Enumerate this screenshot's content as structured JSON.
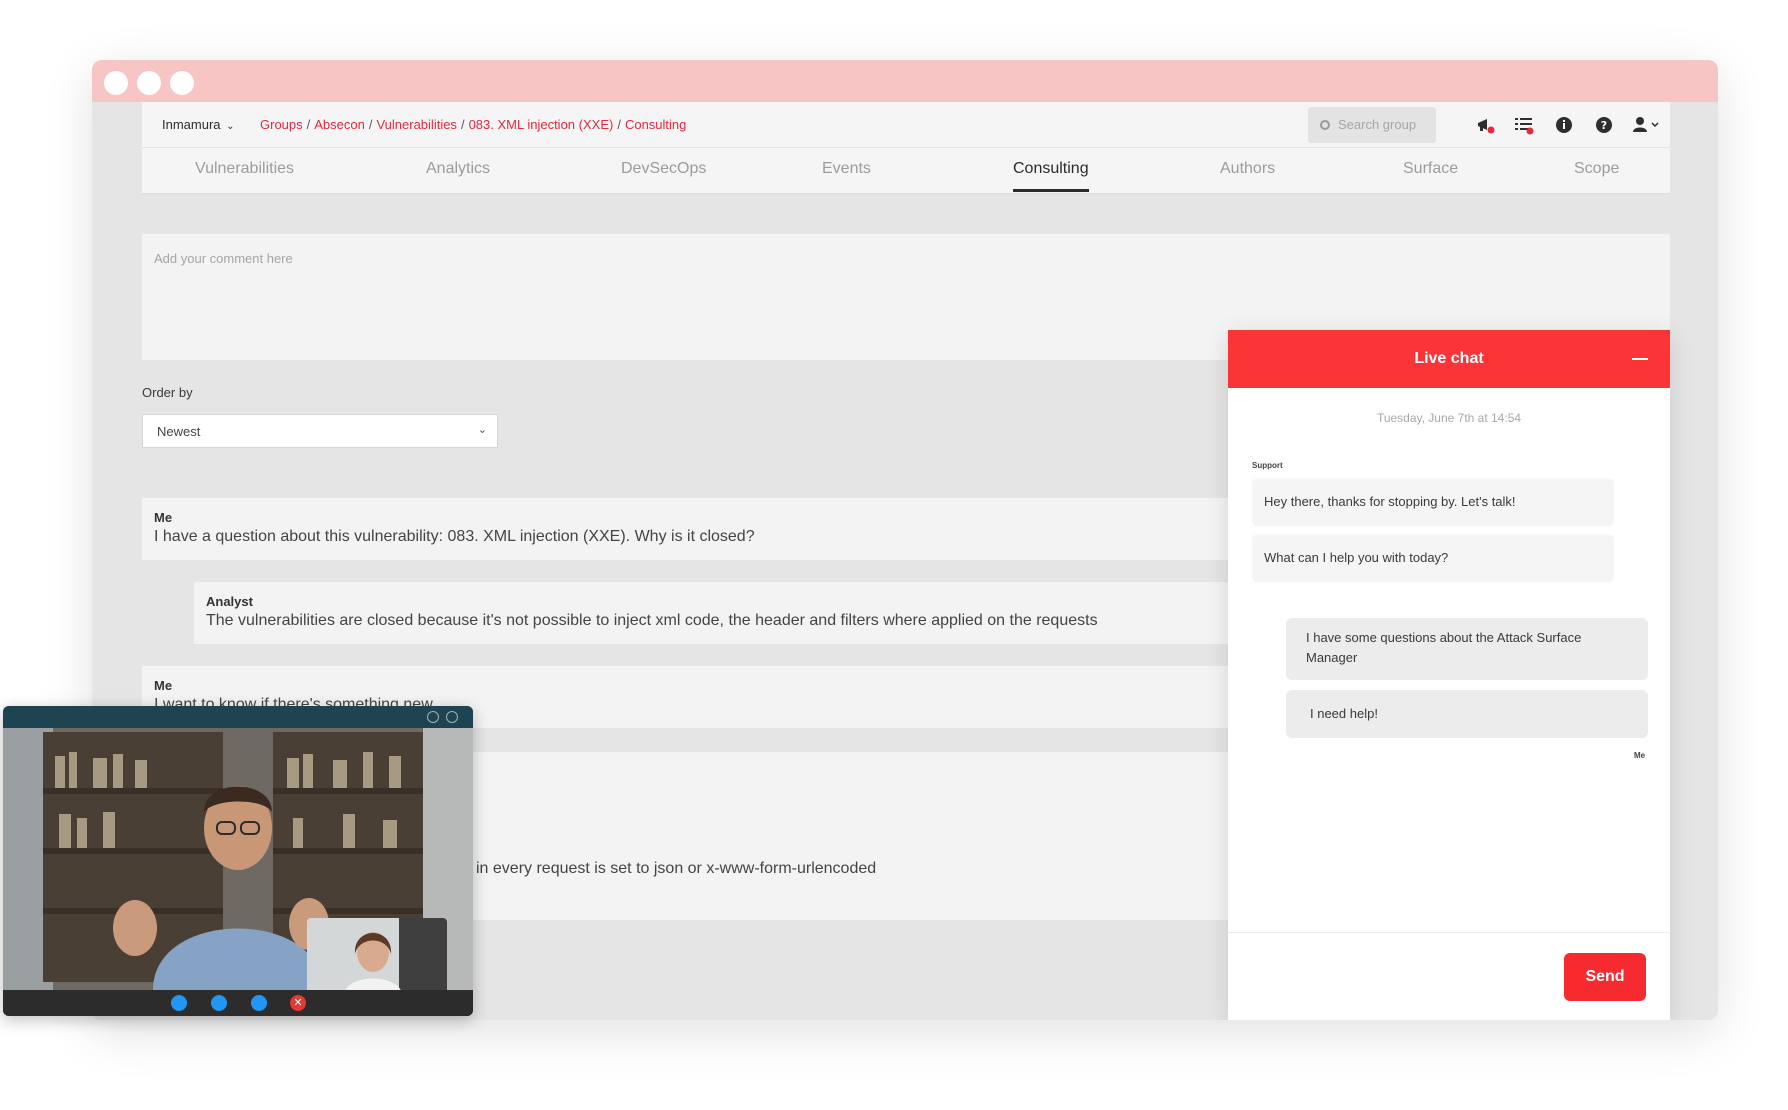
{
  "header": {
    "org": "Inmamura",
    "breadcrumb": [
      "Groups",
      "Absecon",
      "Vulnerabilities",
      "083. XML injection (XXE)",
      "Consulting"
    ],
    "search_placeholder": "Search group"
  },
  "tabs": [
    "Vulnerabilities",
    "Analytics",
    "DevSecOps",
    "Events",
    "Consulting",
    "Authors",
    "Surface",
    "Scope"
  ],
  "active_tab": "Consulting",
  "comment": {
    "placeholder": "Add your comment here"
  },
  "order": {
    "label": "Order by",
    "value": "Newest"
  },
  "comments": [
    {
      "author": "Me",
      "text": "I have a question about this vulnerability: 083. XML injection (XXE). Why is it closed?"
    },
    {
      "author": "Analyst",
      "text": "The vulnerabilities are closed because it's not possible to inject xml code, the header and filters where applied on the requests"
    },
    {
      "author": "Me",
      "text": "I want to know if there's something new"
    },
    {
      "author": "",
      "text": "in every request is set to json or x-www-form-urlencoded"
    }
  ],
  "chat": {
    "title": "Live chat",
    "date": "Tuesday, June 7th at 14:54",
    "support_label": "Support",
    "me_label": "Me",
    "support_messages": [
      "Hey there, thanks for stopping by. Let's talk!",
      "What can I help you with today?"
    ],
    "my_messages": [
      "I have some questions about the Attack Surface Manager",
      "I need help!"
    ],
    "send_label": "Send"
  },
  "colors": {
    "accent": "#fb3537",
    "titlebar": "#f8c5c5",
    "link": "#e8283c"
  },
  "icons": [
    "megaphone-icon",
    "task-list-icon",
    "info-icon",
    "help-icon",
    "user-icon",
    "search-icon",
    "video-icon",
    "signal-icon",
    "chat-icon",
    "hangup-icon"
  ]
}
